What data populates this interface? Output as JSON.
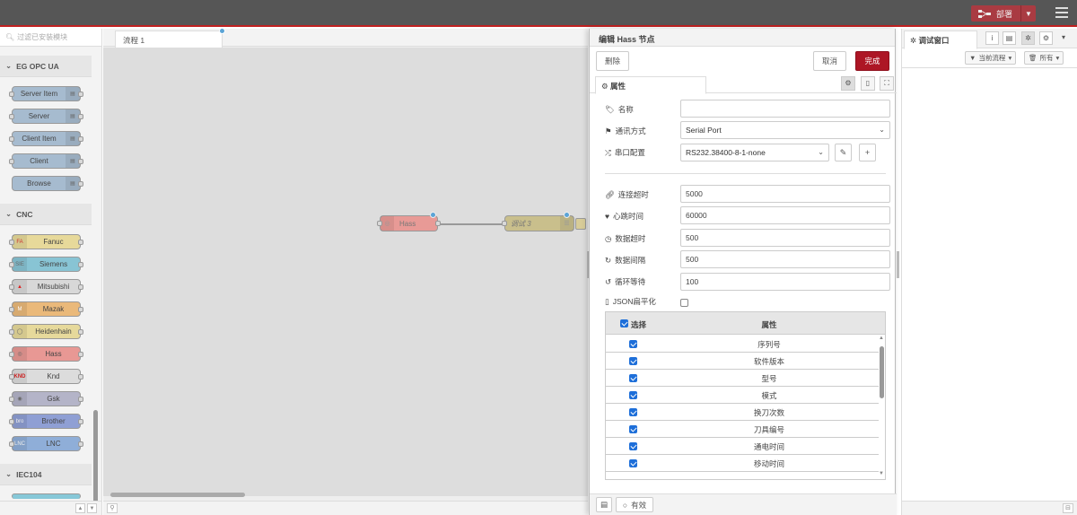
{
  "header": {
    "deploy_label": "部署",
    "menu_icon": "hamburger-icon"
  },
  "palette": {
    "search_placeholder": "过滤已安装模块",
    "categories": [
      {
        "name": "EG OPC UA",
        "nodes": [
          "Server Item",
          "Server",
          "Client Item",
          "Client",
          "Browse"
        ]
      },
      {
        "name": "CNC",
        "nodes": [
          "Fanuc",
          "Siemens",
          "Mitsubishi",
          "Mazak",
          "Heidenhain",
          "Hass",
          "Knd",
          "Gsk",
          "Brother",
          "LNC"
        ]
      },
      {
        "name": "IEC104",
        "nodes": []
      }
    ]
  },
  "workspace": {
    "tab_label": "流程 1",
    "nodes": {
      "hass_label": "Hass",
      "debug_label": "调试 3"
    }
  },
  "tray": {
    "title": "编辑 Hass 节点",
    "delete_label": "删除",
    "cancel_label": "取消",
    "done_label": "完成",
    "tab_properties": "属性",
    "fields": {
      "name_label": "名称",
      "name_value": "",
      "comm_label": "通讯方式",
      "comm_value": "Serial Port",
      "serial_label": "串口配置",
      "serial_value": "RS232.38400-8-1-none",
      "conn_timeout_label": "连接超时",
      "conn_timeout_value": "5000",
      "heartbeat_label": "心跳时间",
      "heartbeat_value": "60000",
      "data_timeout_label": "数据超时",
      "data_timeout_value": "500",
      "data_interval_label": "数据间隔",
      "data_interval_value": "500",
      "loop_wait_label": "循环等待",
      "loop_wait_value": "100",
      "json_flat_label": "JSON扁平化",
      "json_flat_checked": false
    },
    "table": {
      "col_select": "选择",
      "col_property": "属性",
      "rows": [
        {
          "name": "序列号",
          "checked": true
        },
        {
          "name": "软件版本",
          "checked": true
        },
        {
          "name": "型号",
          "checked": true
        },
        {
          "name": "模式",
          "checked": true
        },
        {
          "name": "换刀次数",
          "checked": true
        },
        {
          "name": "刀具编号",
          "checked": true
        },
        {
          "name": "通电时间",
          "checked": true
        },
        {
          "name": "移动时间",
          "checked": true
        }
      ]
    },
    "footer_enabled_label": "有效"
  },
  "sidebar": {
    "tab_label": "调试窗口",
    "filter_flow_label": "当前流程",
    "filter_all_label": "所有"
  }
}
